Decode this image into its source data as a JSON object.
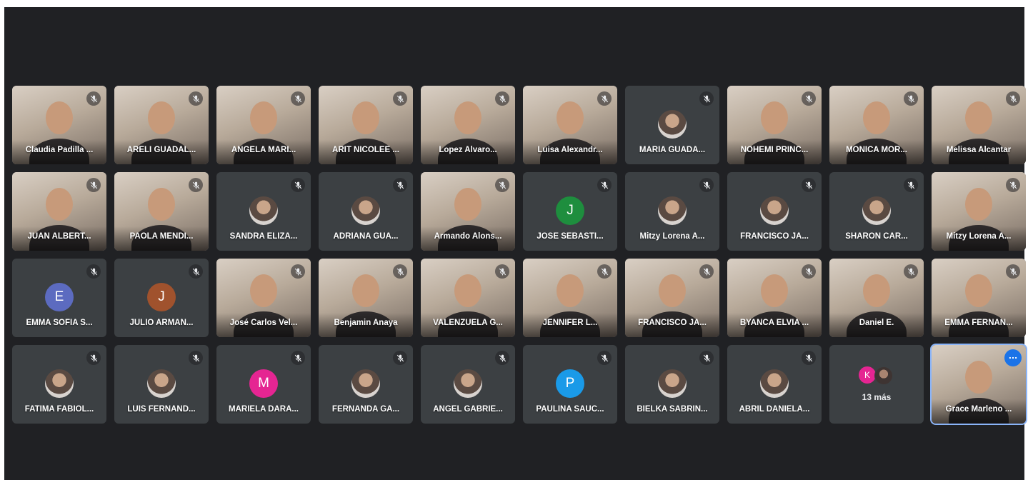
{
  "meeting": {
    "overflow_label": "13 más",
    "overflow_avatar_letter": "K",
    "colors": {
      "stage": "#202124",
      "tile": "#3c4043",
      "self_outline": "#8ab4f8",
      "options_button": "#1a73e8"
    }
  },
  "participants": [
    {
      "name": "Claudia Padilla ...",
      "kind": "video",
      "muted": true
    },
    {
      "name": "ARELI GUADAL...",
      "kind": "video",
      "muted": true
    },
    {
      "name": "ANGELA MARI...",
      "kind": "video",
      "muted": true
    },
    {
      "name": "ARIT NICOLEE ...",
      "kind": "video",
      "muted": true
    },
    {
      "name": "Lopez Alvaro...",
      "kind": "video",
      "muted": true
    },
    {
      "name": "Luisa Alexandr...",
      "kind": "video",
      "muted": true
    },
    {
      "name": "MARIA GUADA...",
      "kind": "photo",
      "muted": true
    },
    {
      "name": "NOHEMI PRINC...",
      "kind": "video",
      "muted": true
    },
    {
      "name": "MONICA MOR...",
      "kind": "video",
      "muted": true
    },
    {
      "name": "Melissa Alcantar",
      "kind": "video",
      "muted": true
    },
    {
      "name": "JUAN ALBERT...",
      "kind": "video",
      "muted": true
    },
    {
      "name": "PAOLA MENDI...",
      "kind": "video",
      "muted": true
    },
    {
      "name": "SANDRA ELIZA...",
      "kind": "photo",
      "muted": true
    },
    {
      "name": "ADRIANA GUA...",
      "kind": "photo",
      "muted": true
    },
    {
      "name": "Armando Alons...",
      "kind": "video",
      "muted": true
    },
    {
      "name": "JOSE SEBASTI...",
      "kind": "letter",
      "letter": "J",
      "color": "#1e8e3e",
      "muted": true
    },
    {
      "name": "Mitzy Lorena A...",
      "kind": "photo",
      "muted": true
    },
    {
      "name": "FRANCISCO JA...",
      "kind": "photo",
      "muted": true
    },
    {
      "name": "SHARON CAR...",
      "kind": "photo",
      "muted": true
    },
    {
      "name": "Mitzy Lorena A...",
      "kind": "video",
      "muted": true
    },
    {
      "name": "EMMA SOFIA S...",
      "kind": "letter",
      "letter": "E",
      "color": "#5c6bc0",
      "muted": true
    },
    {
      "name": "JULIO ARMAN...",
      "kind": "letter",
      "letter": "J",
      "color": "#a0522d",
      "muted": true
    },
    {
      "name": "José Carlos Vel...",
      "kind": "video",
      "muted": true
    },
    {
      "name": "Benjamin Anaya",
      "kind": "video",
      "muted": true
    },
    {
      "name": "VALENZUELA G...",
      "kind": "video",
      "muted": true
    },
    {
      "name": "JENNIFER L...",
      "kind": "video",
      "muted": true
    },
    {
      "name": "FRANCISCO JA...",
      "kind": "video",
      "muted": true
    },
    {
      "name": "BYANCA ELVIA ...",
      "kind": "video",
      "muted": true
    },
    {
      "name": "Daniel E.",
      "kind": "video",
      "muted": true
    },
    {
      "name": "EMMA FERNAN...",
      "kind": "video",
      "muted": true
    },
    {
      "name": "FATIMA FABIOL...",
      "kind": "photo",
      "muted": true
    },
    {
      "name": "LUIS FERNAND...",
      "kind": "photo",
      "muted": true
    },
    {
      "name": "MARIELA DARA...",
      "kind": "letter",
      "letter": "M",
      "color": "#e52592",
      "muted": true
    },
    {
      "name": "FERNANDA GA...",
      "kind": "photo",
      "muted": true
    },
    {
      "name": "ANGEL GABRIE...",
      "kind": "photo",
      "muted": true
    },
    {
      "name": "PAULINA SAUC...",
      "kind": "letter",
      "letter": "P",
      "color": "#1a9ae8",
      "muted": true
    },
    {
      "name": "BIELKA SABRIN...",
      "kind": "photo",
      "muted": true
    },
    {
      "name": "ABRIL DANIELA...",
      "kind": "photo",
      "muted": true
    },
    {
      "name": "",
      "kind": "more",
      "muted": false
    },
    {
      "name": "Grace Marleno ...",
      "kind": "self",
      "muted": false
    }
  ]
}
